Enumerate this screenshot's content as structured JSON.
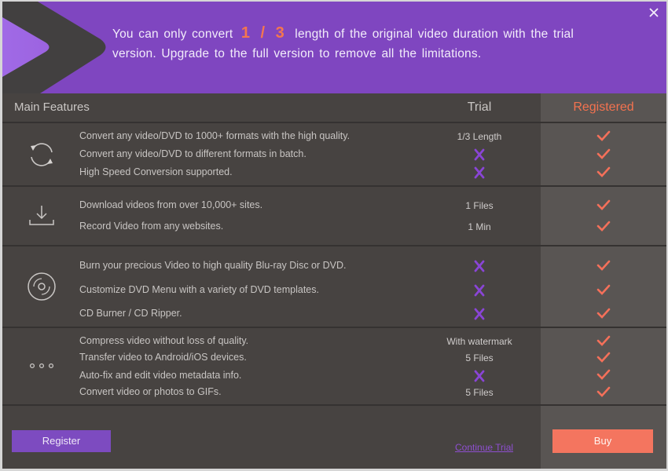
{
  "banner": {
    "text_before": "You can only convert",
    "fraction": "1 / 3",
    "text_after": "length of the original video duration with the trial version. Upgrade to the full version to remove all the limitations.",
    "close_icon": "close-icon"
  },
  "colors": {
    "banner_bg": "#7f46c0",
    "accent_orange": "#f4724f",
    "accent_purple": "#8a45d6",
    "panel_bg": "#474341",
    "registered_bg": "#595553"
  },
  "table": {
    "headers": {
      "features": "Main Features",
      "trial": "Trial",
      "registered": "Registered"
    },
    "groups": [
      {
        "icon": "convert-icon",
        "rows": [
          {
            "feature": "Convert any video/DVD to 1000+ formats with the high quality.",
            "trial": "1/3 Length",
            "trial_type": "text",
            "registered": "check"
          },
          {
            "feature": "Convert any video/DVD to different formats in batch.",
            "trial": "",
            "trial_type": "cross",
            "registered": "check"
          },
          {
            "feature": "High Speed Conversion supported.",
            "trial": "",
            "trial_type": "cross",
            "registered": "check"
          }
        ]
      },
      {
        "icon": "download-icon",
        "rows": [
          {
            "feature": "Download videos from over 10,000+ sites.",
            "trial": "1 Files",
            "trial_type": "text",
            "registered": "check"
          },
          {
            "feature": "Record Video from any websites.",
            "trial": "1 Min",
            "trial_type": "text",
            "registered": "check"
          }
        ]
      },
      {
        "icon": "disc-icon",
        "rows": [
          {
            "feature": "Burn your precious Video to high quality Blu-ray Disc or DVD.",
            "trial": "",
            "trial_type": "cross",
            "registered": "check"
          },
          {
            "feature": "Customize DVD Menu with a variety of DVD templates.",
            "trial": "",
            "trial_type": "cross",
            "registered": "check"
          },
          {
            "feature": "CD Burner / CD Ripper.",
            "trial": "",
            "trial_type": "cross",
            "registered": "check"
          }
        ]
      },
      {
        "icon": "more-icon",
        "rows": [
          {
            "feature": "Compress video without loss of quality.",
            "trial": "With watermark",
            "trial_type": "text",
            "registered": "check"
          },
          {
            "feature": "Transfer video to Android/iOS devices.",
            "trial": "5 Files",
            "trial_type": "text",
            "registered": "check"
          },
          {
            "feature": "Auto-fix and edit video metadata info.",
            "trial": "",
            "trial_type": "cross",
            "registered": "check"
          },
          {
            "feature": "Convert video or photos to GIFs.",
            "trial": "5 Files",
            "trial_type": "text",
            "registered": "check"
          }
        ]
      }
    ]
  },
  "footer": {
    "register_label": "Register",
    "continue_label": "Continue Trial",
    "buy_label": "Buy"
  }
}
